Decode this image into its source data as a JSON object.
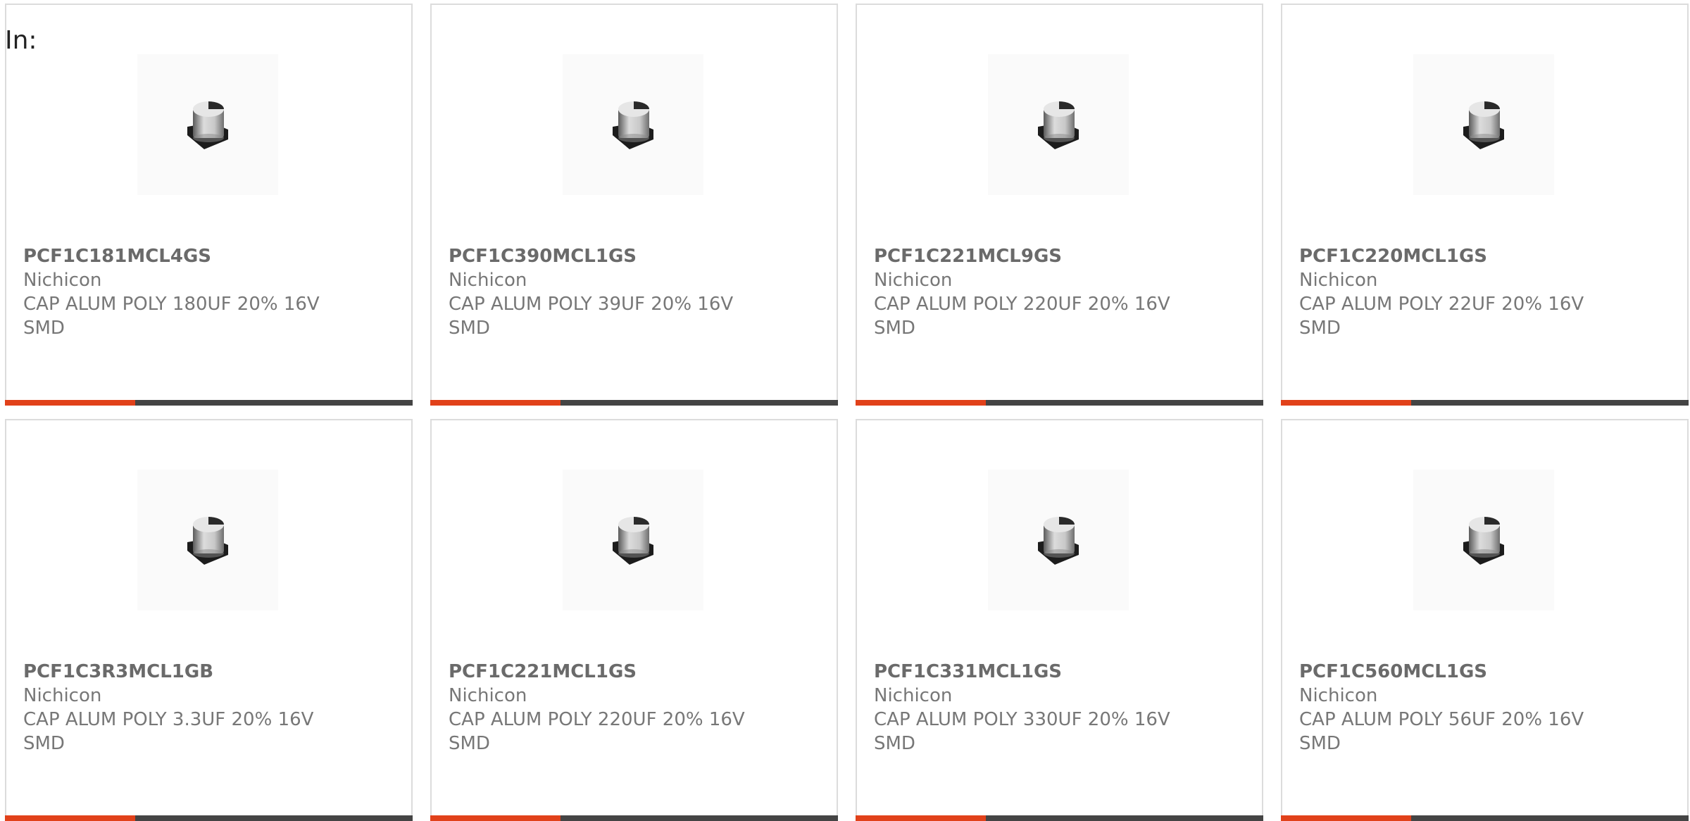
{
  "page": {
    "heading": "In:"
  },
  "colors": {
    "accent": "#e1411a",
    "bar_dark": "#444444",
    "card_border": "#dcdcdc"
  },
  "products": [
    {
      "part": "PCF1C181MCL4GS",
      "brand": "Nichicon",
      "desc": "CAP ALUM POLY 180UF 20% 16V",
      "pkg": "SMD",
      "icon": "capacitor-smd-icon"
    },
    {
      "part": "PCF1C390MCL1GS",
      "brand": "Nichicon",
      "desc": "CAP ALUM POLY 39UF 20% 16V",
      "pkg": "SMD",
      "icon": "capacitor-smd-icon"
    },
    {
      "part": "PCF1C221MCL9GS",
      "brand": "Nichicon",
      "desc": "CAP ALUM POLY 220UF 20% 16V",
      "pkg": "SMD",
      "icon": "capacitor-smd-icon"
    },
    {
      "part": "PCF1C220MCL1GS",
      "brand": "Nichicon",
      "desc": "CAP ALUM POLY 22UF 20% 16V",
      "pkg": "SMD",
      "icon": "capacitor-smd-icon"
    },
    {
      "part": "PCF1C3R3MCL1GB",
      "brand": "Nichicon",
      "desc": "CAP ALUM POLY 3.3UF 20% 16V",
      "pkg": "SMD",
      "icon": "capacitor-smd-icon"
    },
    {
      "part": "PCF1C221MCL1GS",
      "brand": "Nichicon",
      "desc": "CAP ALUM POLY 220UF 20% 16V",
      "pkg": "SMD",
      "icon": "capacitor-smd-icon"
    },
    {
      "part": "PCF1C331MCL1GS",
      "brand": "Nichicon",
      "desc": "CAP ALUM POLY 330UF 20% 16V",
      "pkg": "SMD",
      "icon": "capacitor-smd-icon"
    },
    {
      "part": "PCF1C560MCL1GS",
      "brand": "Nichicon",
      "desc": "CAP ALUM POLY 56UF 20% 16V",
      "pkg": "SMD",
      "icon": "capacitor-smd-icon"
    }
  ]
}
